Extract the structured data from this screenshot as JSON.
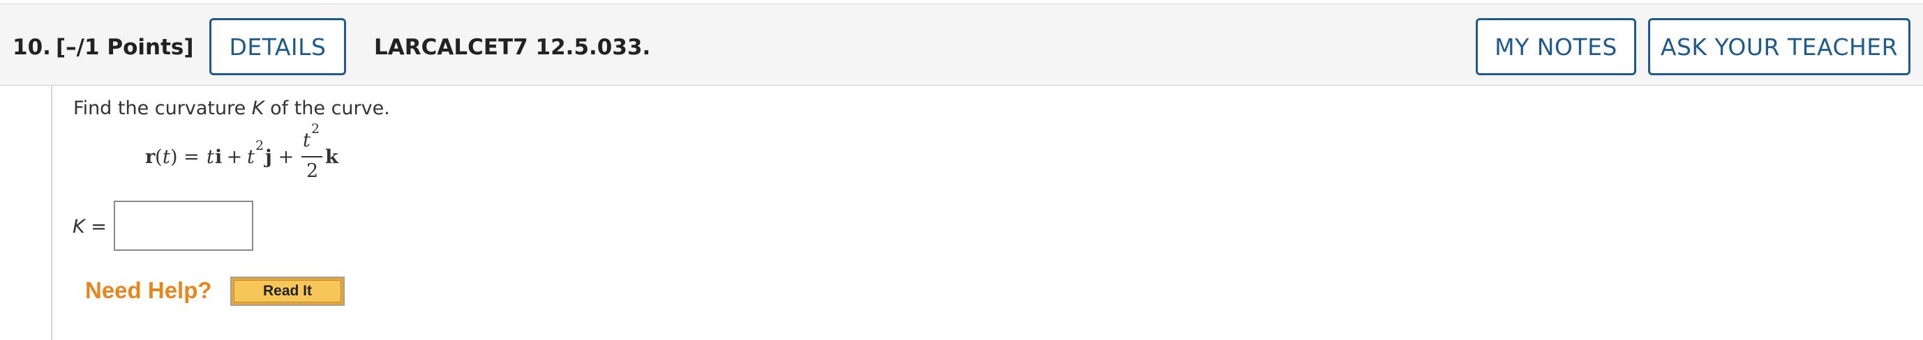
{
  "question": {
    "number": "10.",
    "points": "[–/1 Points]",
    "details_label": "DETAILS",
    "code": "LARCALCET7 12.5.033.",
    "my_notes_label": "MY NOTES",
    "ask_teacher_label": "ASK YOUR TEACHER"
  },
  "prompt": {
    "before": "Find the curvature ",
    "var": "K",
    "after": " of the curve."
  },
  "formula": {
    "r": "r",
    "paren_open": "(",
    "t": "t",
    "paren_close_eq": ") = ",
    "t2": "t",
    "i": "i",
    "plus1": " + ",
    "t3": "t",
    "exp1": "2",
    "j": "j",
    "plus2": " + ",
    "num_t": "t",
    "num_exp": "2",
    "den": "2",
    "k": "k"
  },
  "answer": {
    "label_var": "K",
    "label_eq": " =",
    "value": ""
  },
  "help": {
    "need_help": "Need Help?",
    "read_it": "Read It"
  }
}
